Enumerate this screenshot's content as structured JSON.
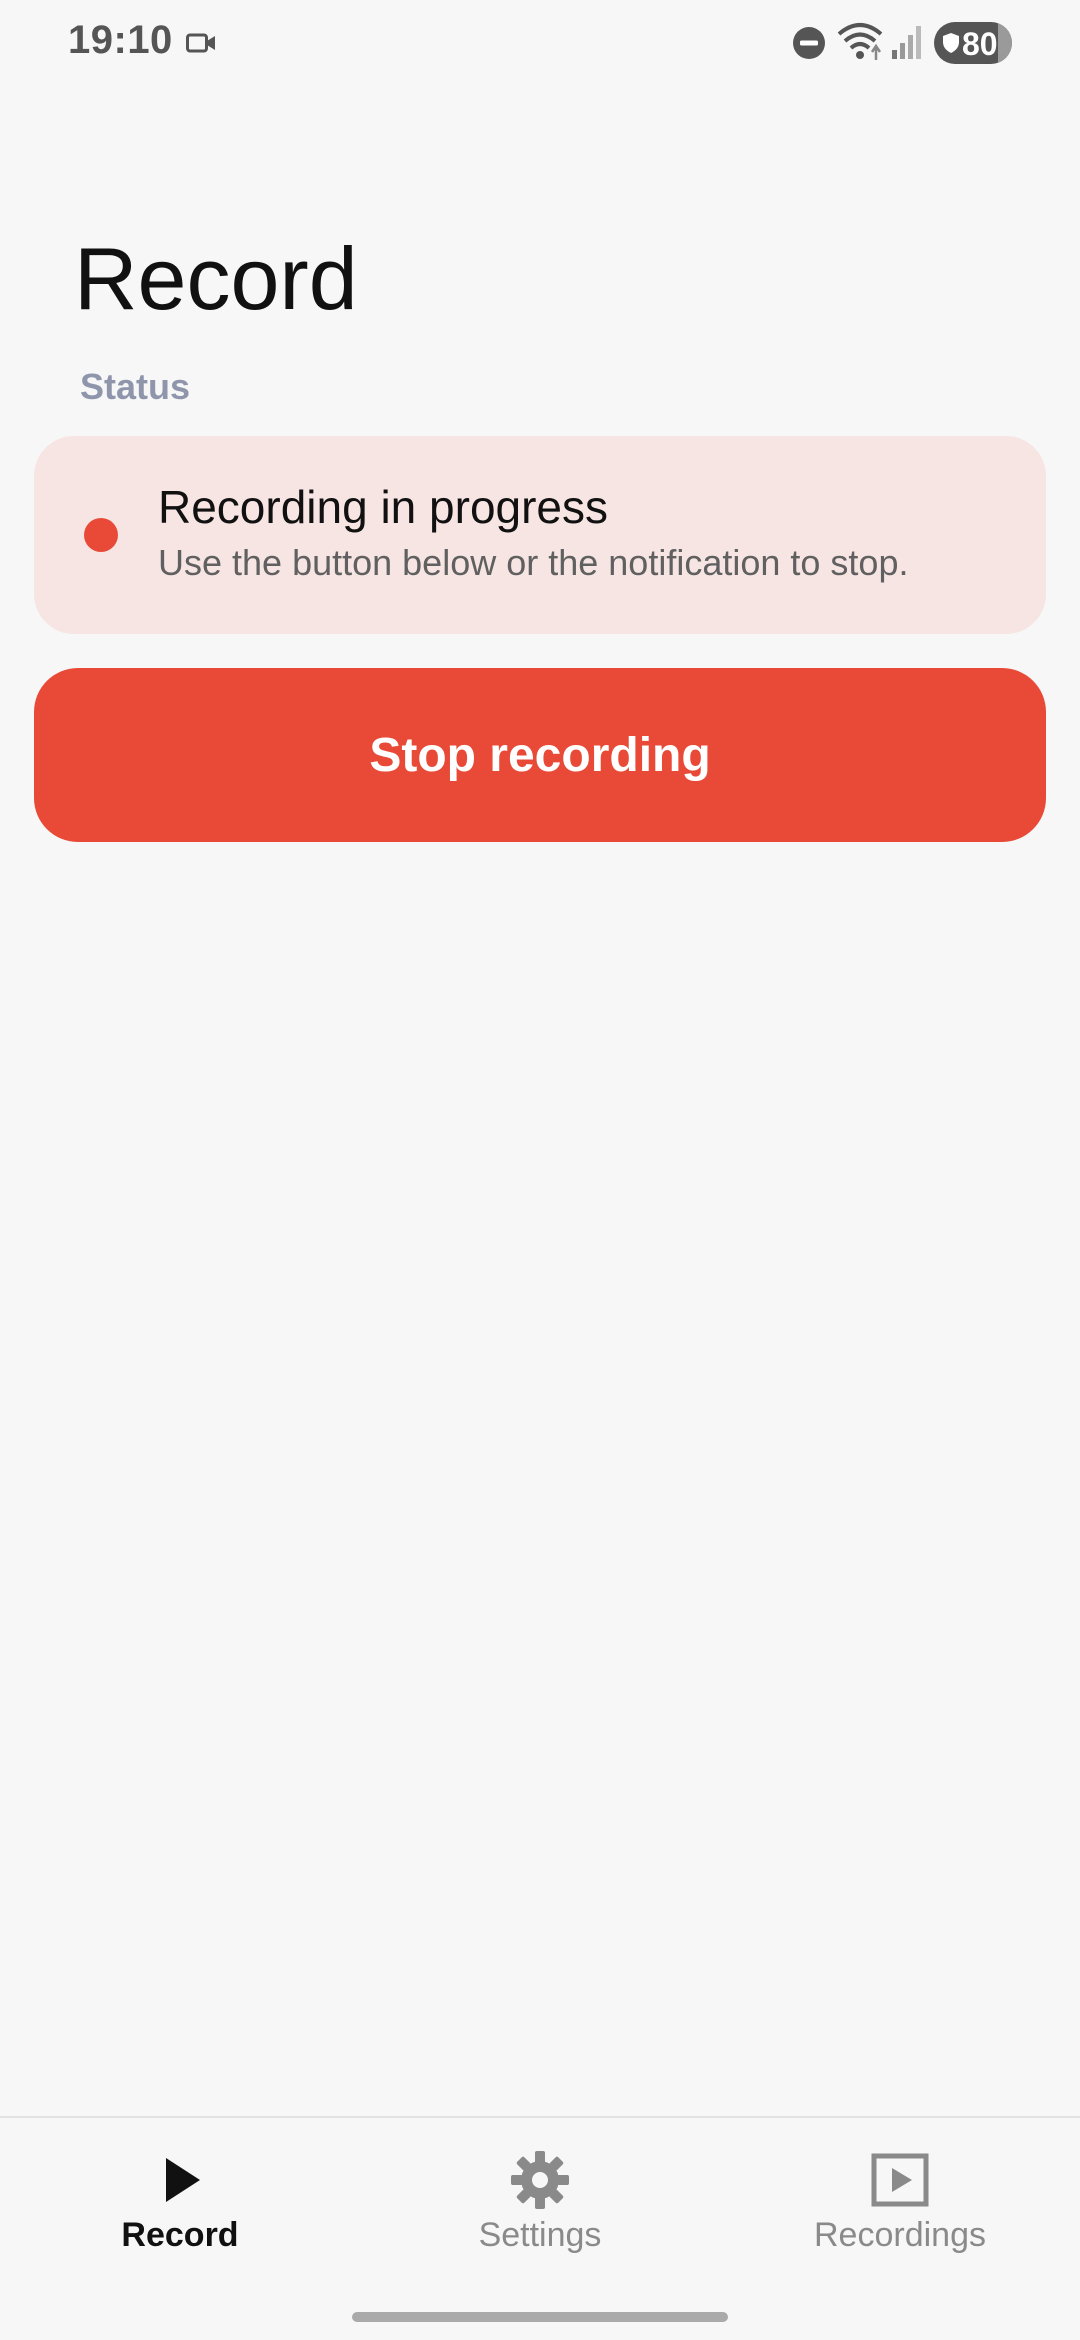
{
  "status_bar": {
    "time": "19:10",
    "battery_level": "80",
    "icons": [
      "video-camera-icon",
      "do-not-disturb-icon",
      "wifi-icon",
      "cell-signal-icon",
      "battery-icon"
    ]
  },
  "page": {
    "title": "Record",
    "section_label": "Status"
  },
  "status_card": {
    "title": "Recording in progress",
    "subtitle": "Use the button below or the notification to stop.",
    "dot_color": "#e84a37",
    "background": "#f7e5e3"
  },
  "stop_button": {
    "label": "Stop recording",
    "color": "#e84a37"
  },
  "bottom_nav": {
    "items": [
      {
        "label": "Record",
        "icon": "play-icon",
        "active": true
      },
      {
        "label": "Settings",
        "icon": "gear-icon",
        "active": false
      },
      {
        "label": "Recordings",
        "icon": "video-library-icon",
        "active": false
      }
    ]
  }
}
